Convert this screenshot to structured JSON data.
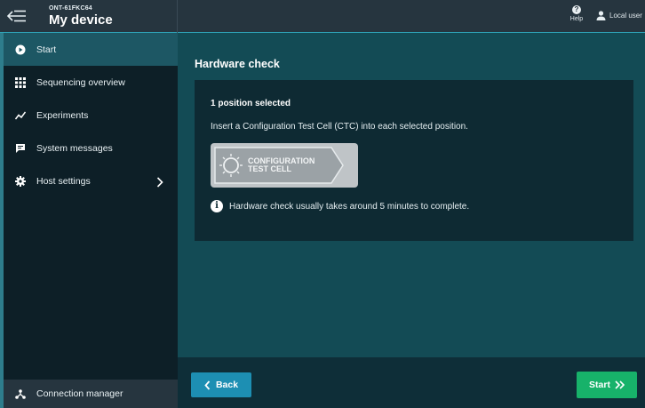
{
  "header": {
    "device_id": "ONT-61FKC64",
    "device_name": "My device",
    "help_label": "Help",
    "user_label": "Local user"
  },
  "sidebar": {
    "items": [
      {
        "label": "Start",
        "icon": "play-circle-icon",
        "active": true
      },
      {
        "label": "Sequencing overview",
        "icon": "grid-icon"
      },
      {
        "label": "Experiments",
        "icon": "trend-line-icon"
      },
      {
        "label": "System messages",
        "icon": "chat-bubble-icon"
      },
      {
        "label": "Host settings",
        "icon": "gear-icon"
      }
    ],
    "connection_manager": "Connection manager"
  },
  "main": {
    "title": "Hardware check",
    "selection": "1 position selected",
    "instruction": "Insert a Configuration Test Cell (CTC) into each selected position.",
    "ctc_line1": "CONFIGURATION",
    "ctc_line2": "TEST CELL",
    "info": "Hardware check usually takes around 5 minutes to complete."
  },
  "footer": {
    "back_label": "Back",
    "start_label": "Start"
  },
  "colors": {
    "accent": "#1d8fb3",
    "start_button": "#17b26a",
    "active_nav": "#1d5764"
  }
}
